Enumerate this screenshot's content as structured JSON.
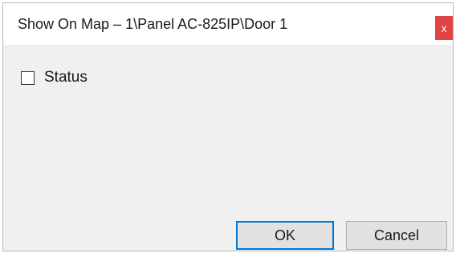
{
  "window": {
    "title": "Show On Map – 1\\Panel  AC-825IP\\Door 1",
    "close_label": "x"
  },
  "content": {
    "status_checkbox": {
      "label": "Status",
      "checked": false
    }
  },
  "buttons": {
    "ok_label": "OK",
    "cancel_label": "Cancel"
  },
  "colors": {
    "close_button": "#e04343",
    "ok_focus_border": "#0078d7",
    "dialog_background": "#f0f0f0"
  }
}
